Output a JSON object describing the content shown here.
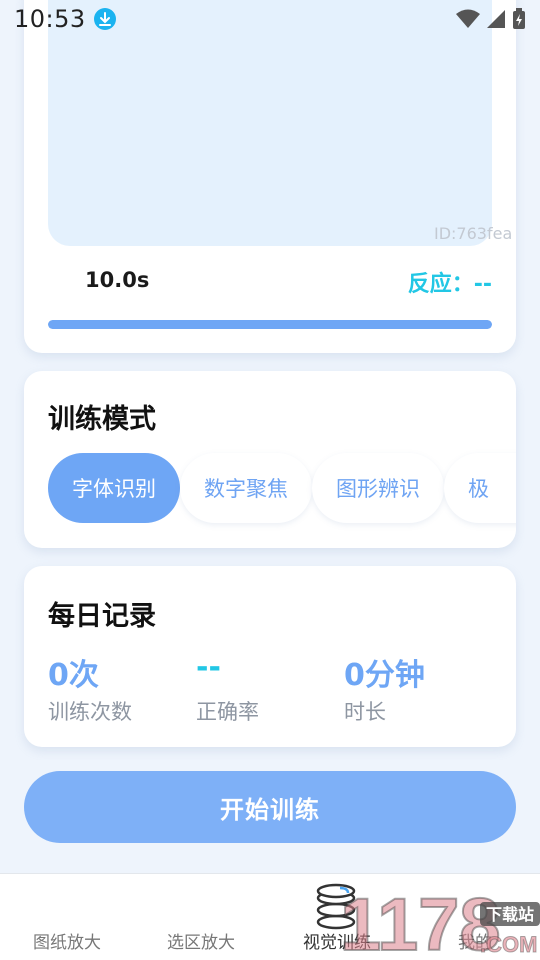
{
  "status_bar": {
    "time": "10:53"
  },
  "training_card": {
    "watermark": "ID:763fea",
    "timer": "10.0s",
    "reaction": "反应：--",
    "progress": 1.0
  },
  "mode_section": {
    "title": "训练模式",
    "modes": [
      {
        "label": "字体识别",
        "active": true
      },
      {
        "label": "数字聚焦",
        "active": false
      },
      {
        "label": "图形辨识",
        "active": false
      },
      {
        "label": "极",
        "active": false
      }
    ]
  },
  "record_section": {
    "title": "每日记录",
    "stats": [
      {
        "value": "0次",
        "label": "训练次数"
      },
      {
        "value": "--",
        "label": "正确率"
      },
      {
        "value": "0分钟",
        "label": "时长"
      }
    ]
  },
  "start_button": {
    "label": "开始训练"
  },
  "bottom_nav": {
    "items": [
      {
        "label": "图纸放大"
      },
      {
        "label": "选区放大"
      },
      {
        "label": "视觉训练",
        "active": true
      },
      {
        "label": "我的"
      }
    ]
  },
  "watermark_brand": {
    "text": "1178",
    "badge": "下载站",
    "suffix": ".COM"
  },
  "colors": {
    "accent": "#6ea6f5",
    "cyan": "#22c7e5",
    "background": "#eef4fc"
  }
}
